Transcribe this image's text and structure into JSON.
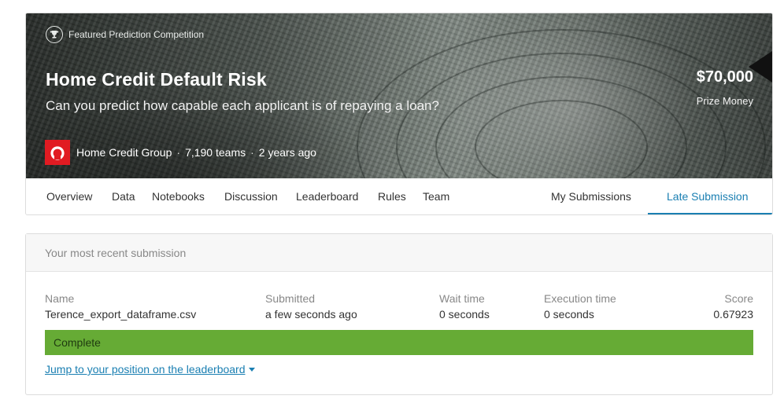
{
  "header": {
    "featured_label": "Featured Prediction Competition",
    "title": "Home Credit Default Risk",
    "subtitle": "Can you predict how capable each applicant is of repaying a loan?",
    "prize_amount": "$70,000",
    "prize_label": "Prize Money",
    "host": "Home Credit Group",
    "teams": "7,190 teams",
    "age": "2 years ago",
    "separator": "·"
  },
  "tabs": {
    "left": [
      "Overview",
      "Data",
      "Notebooks",
      "Discussion",
      "Leaderboard",
      "Rules",
      "Team"
    ],
    "right": [
      "My Submissions",
      "Late Submission"
    ],
    "active": "Late Submission"
  },
  "submission": {
    "heading": "Your most recent submission",
    "columns": [
      {
        "label": "Name",
        "value": "Terence_export_dataframe.csv"
      },
      {
        "label": "Submitted",
        "value": "a few seconds ago"
      },
      {
        "label": "Wait time",
        "value": "0 seconds"
      },
      {
        "label": "Execution time",
        "value": "0 seconds"
      },
      {
        "label": "Score",
        "value": "0.67923"
      }
    ],
    "status": "Complete",
    "jump_link": "Jump to your position on the leaderboard"
  },
  "colors": {
    "accent": "#1a7fb2",
    "status_green": "#66ab35",
    "host_logo": "#e11b22"
  },
  "icons": {
    "featured": "trophy-icon",
    "host": "home-credit-logo",
    "dropdown": "caret-down-icon"
  }
}
